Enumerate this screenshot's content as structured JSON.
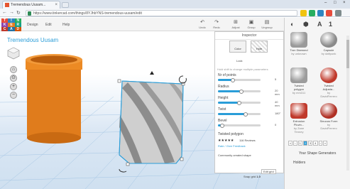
{
  "browser": {
    "tab_title": "Tremendous Uusam...",
    "tab_close": "×",
    "url": "https://www.tinkercad.com/things/8YJhbYNS-tremendous-uusam/edit",
    "win_min": "–",
    "win_max": "□",
    "win_close": "×"
  },
  "app": {
    "logo_letters": [
      "T",
      "I",
      "N",
      "K",
      "E",
      "R",
      "C",
      "A",
      "D"
    ],
    "menu": [
      "Design",
      "Edit",
      "Help"
    ],
    "tools": [
      {
        "label": "Undo",
        "glyph": "↶"
      },
      {
        "label": "Redo",
        "glyph": "↷"
      },
      {
        "label": "Adjust",
        "glyph": "⊞"
      },
      {
        "label": "Group",
        "glyph": "▣"
      },
      {
        "label": "Ungroup",
        "glyph": "▤"
      }
    ],
    "design_name": "Tremendous Uusam"
  },
  "inspector": {
    "title": "Inspector",
    "color_label": "Color",
    "hole_label": "Hole",
    "lock_label": "Lock",
    "hint": "Hold shift to change multiple parameters",
    "params": [
      {
        "name": "Nr of points",
        "value": "5",
        "fraction": 0.35
      },
      {
        "name": "Radius",
        "value": "20 mm",
        "fraction": 0.55
      },
      {
        "name": "Height",
        "value": "40 mm",
        "fraction": 0.5
      },
      {
        "name": "Twist",
        "value": "180°",
        "fraction": 0.65
      },
      {
        "name": "Bevel",
        "value": "0",
        "fraction": 0.1
      }
    ],
    "shape_title": "Twisted polygon",
    "rating_stars": "★★★★★",
    "rating_text": "116 Reviews",
    "rate_link": "Rate / Give Feedback",
    "community_text": "Community created shape"
  },
  "rpanel": {
    "icons": [
      "◐",
      "⬢",
      "A",
      "1"
    ],
    "shapes": [
      {
        "name": "Tron Diamond",
        "author": "by unknown",
        "color": "#9a9a9a"
      },
      {
        "name": "Capsule",
        "author": "by daftpunk",
        "color": "#8a8a8a"
      },
      {
        "name": "Twisted polygon",
        "author": "by mm311",
        "color": "#9c9c9c"
      },
      {
        "name": "Twisted Adjusta...",
        "author": "by DavidFerrero",
        "color": "#c0392b"
      },
      {
        "name": "Extrusion Pluvin...",
        "author": "by Zane Tenney",
        "color": "#c0392b"
      },
      {
        "name": "Sinuous Form",
        "author": "by DavidFerrero",
        "color": "#b03024"
      }
    ],
    "pager": [
      "«",
      "‹",
      "1",
      "2",
      "3",
      "4",
      "›",
      "»"
    ],
    "section1": "Your Shape Generators",
    "section2": "Holders"
  },
  "workplane": {
    "edit_grid": "Edit grid",
    "snap_label": "Snap grid",
    "snap_value": "1.0"
  },
  "colors": {
    "accent": "#2a9dd8",
    "logo": [
      "#e74c3c",
      "#2e86c1",
      "#27ae60",
      "#8e44ad",
      "#e67e22",
      "#16a085",
      "#c0392b",
      "#2471a3",
      "#d35400"
    ]
  }
}
